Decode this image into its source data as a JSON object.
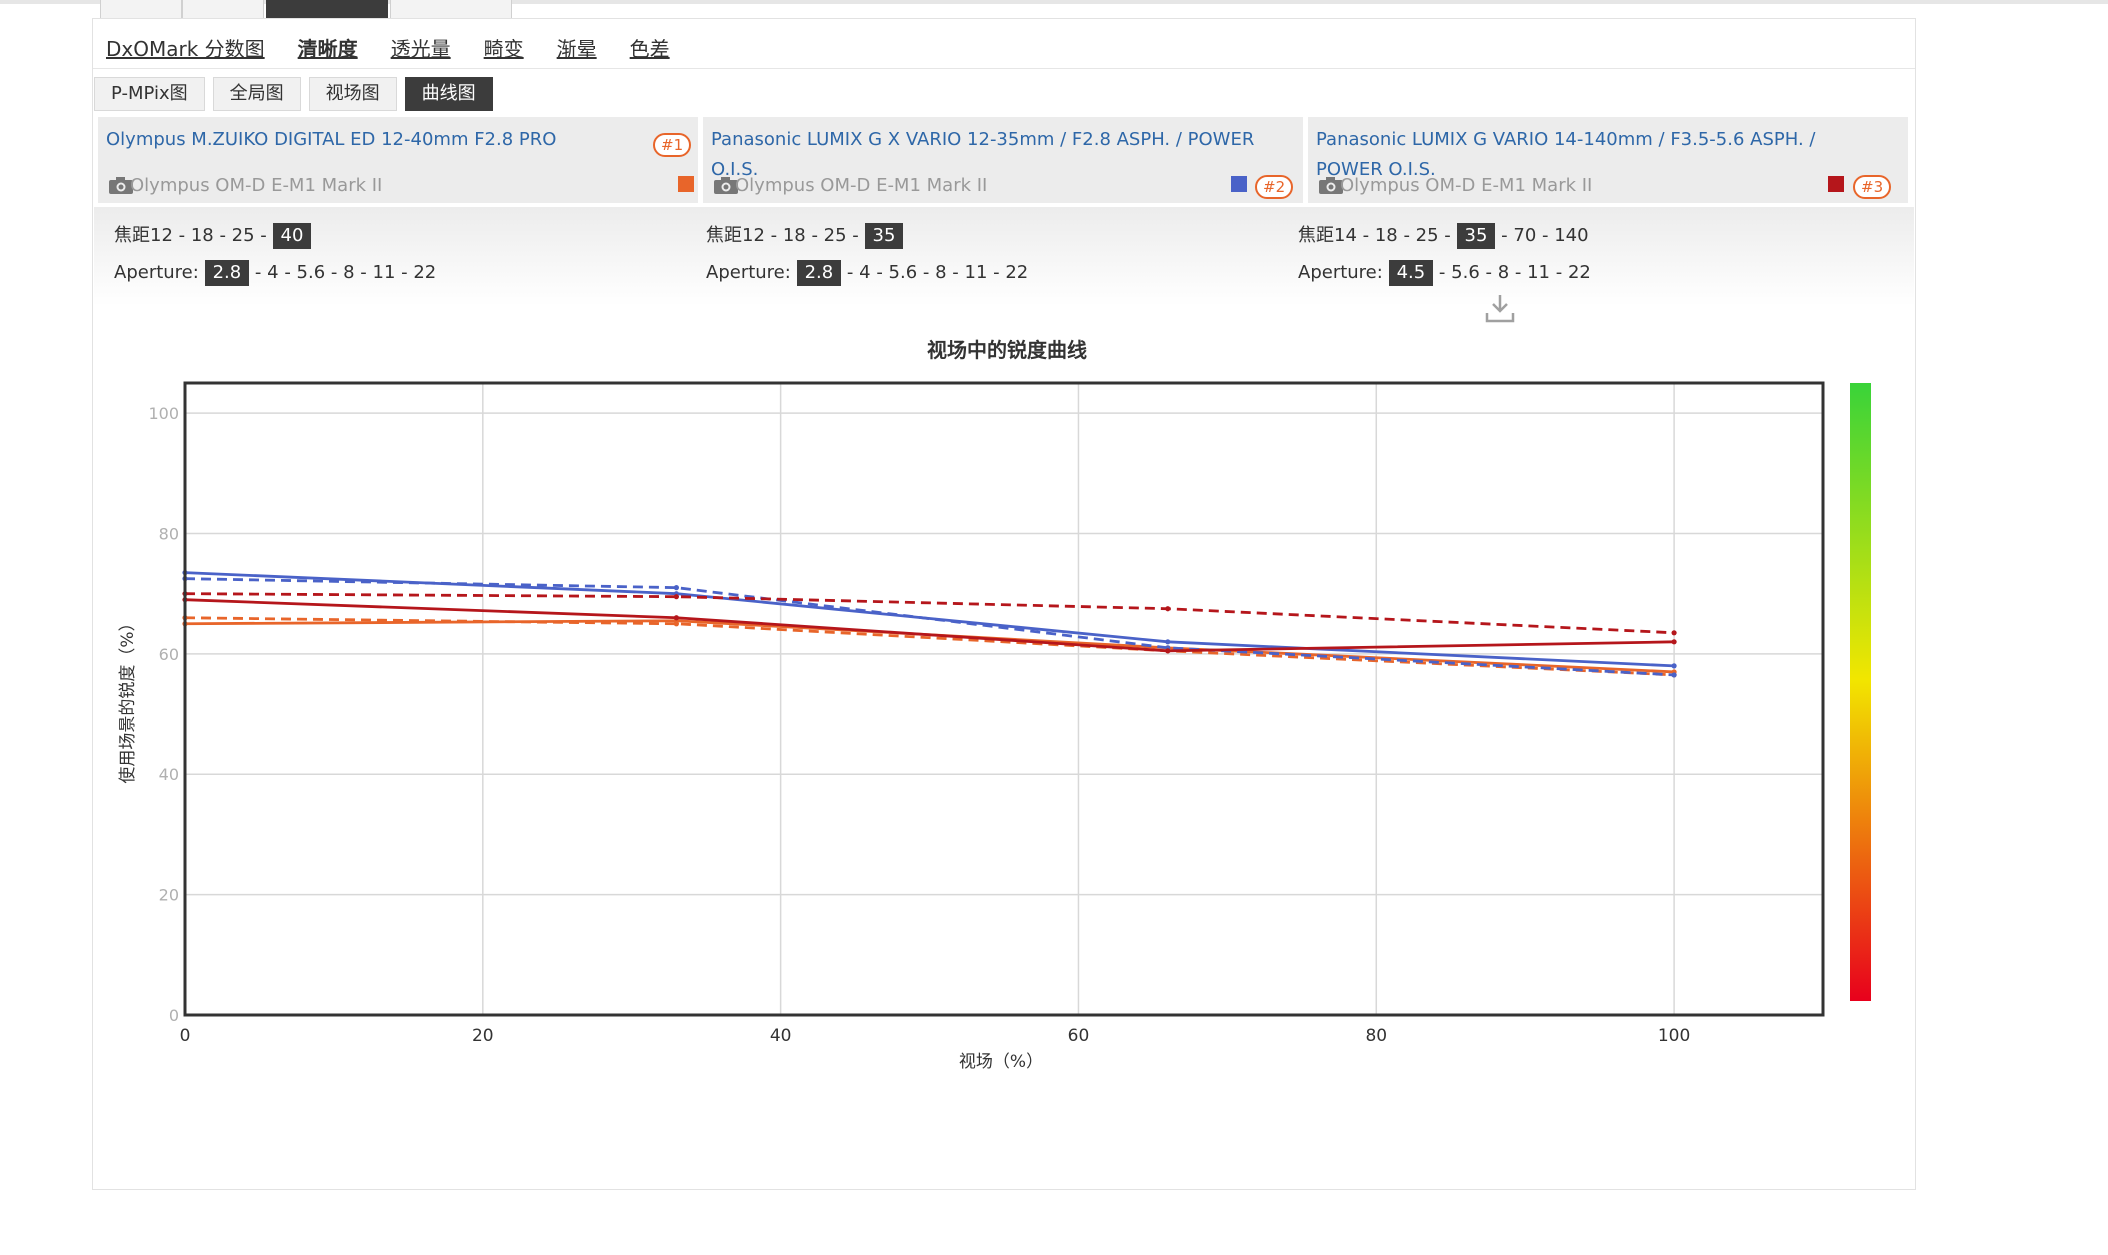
{
  "nav": {
    "items": [
      {
        "label": "DxOMark 分数图",
        "active": false
      },
      {
        "label": "清晰度",
        "active": true
      },
      {
        "label": "透光量",
        "active": false
      },
      {
        "label": "畸变",
        "active": false
      },
      {
        "label": "渐晕",
        "active": false
      },
      {
        "label": "色差",
        "active": false
      }
    ]
  },
  "subtabs": [
    {
      "label": "P-MPix图",
      "active": false
    },
    {
      "label": "全局图",
      "active": false
    },
    {
      "label": "视场图",
      "active": false
    },
    {
      "label": "曲线图",
      "active": true
    }
  ],
  "lenses": [
    {
      "name": "Olympus M.ZUIKO DIGITAL ED 12-40mm F2.8 PRO",
      "camera": "Olympus OM-D E-M1 Mark II",
      "rank": "#1",
      "color": "#e8652a",
      "focal_prefix": "焦距",
      "focals_before": "12 - 18 - 25 - ",
      "focal_selected": "40",
      "focals_after": "",
      "aperture_label": "Aperture:",
      "aperture_selected": "2.8",
      "apertures_after": " - 4 - 5.6 - 8 - 11 - 22"
    },
    {
      "name": "Panasonic LUMIX G X VARIO 12-35mm / F2.8 ASPH. / POWER O.I.S.",
      "camera": "Olympus OM-D E-M1 Mark II",
      "rank": "#2",
      "color": "#4a62c8",
      "focal_prefix": "焦距",
      "focals_before": "12 - 18 - 25 - ",
      "focal_selected": "35",
      "focals_after": "",
      "aperture_label": "Aperture:",
      "aperture_selected": "2.8",
      "apertures_after": " - 4 - 5.6 - 8 - 11 - 22"
    },
    {
      "name": "Panasonic LUMIX G VARIO 14-140mm / F3.5-5.6 ASPH. / POWER O.I.S.",
      "camera": "Olympus OM-D E-M1 Mark II",
      "rank": "#3",
      "color": "#b5161b",
      "focal_prefix": "焦距",
      "focals_before": "14 - 18 - 25 - ",
      "focal_selected": "35",
      "focals_after": " - 70 - 140",
      "aperture_label": "Aperture:",
      "aperture_selected": "4.5",
      "apertures_after": " - 5.6 - 8 - 11 - 22"
    }
  ],
  "chart_data": {
    "type": "line",
    "title": "视场中的锐度曲线",
    "xlabel": "视场（%）",
    "ylabel": "使用场景的锐度（%）",
    "xlim": [
      0,
      110
    ],
    "ylim": [
      0,
      105
    ],
    "xticks": [
      0,
      20,
      40,
      60,
      80,
      100
    ],
    "yticks": [
      0,
      20,
      40,
      60,
      80,
      100
    ],
    "grid": true,
    "colorbar": {
      "top": "#39d339",
      "middle": "#f2e600",
      "bottom": "#e8001c"
    },
    "series": [
      {
        "lens": 1,
        "dashed": false,
        "color": "#e8652a",
        "x": [
          0,
          33,
          66,
          100
        ],
        "y": [
          65,
          65.5,
          61,
          57
        ]
      },
      {
        "lens": 1,
        "dashed": true,
        "color": "#e8652a",
        "x": [
          0,
          33,
          66,
          100
        ],
        "y": [
          66,
          65,
          60.5,
          56.5
        ]
      },
      {
        "lens": 2,
        "dashed": false,
        "color": "#4a62c8",
        "x": [
          0,
          33,
          66,
          100
        ],
        "y": [
          73.5,
          70,
          62,
          58
        ]
      },
      {
        "lens": 2,
        "dashed": true,
        "color": "#4a62c8",
        "x": [
          0,
          33,
          66,
          100
        ],
        "y": [
          72.5,
          71,
          61,
          56.5
        ]
      },
      {
        "lens": 3,
        "dashed": false,
        "color": "#b5161b",
        "x": [
          0,
          33,
          66,
          100
        ],
        "y": [
          69,
          66,
          60.5,
          62
        ]
      },
      {
        "lens": 3,
        "dashed": true,
        "color": "#b5161b",
        "x": [
          0,
          33,
          66,
          100
        ],
        "y": [
          70,
          69.5,
          67.5,
          63.5
        ]
      }
    ]
  }
}
